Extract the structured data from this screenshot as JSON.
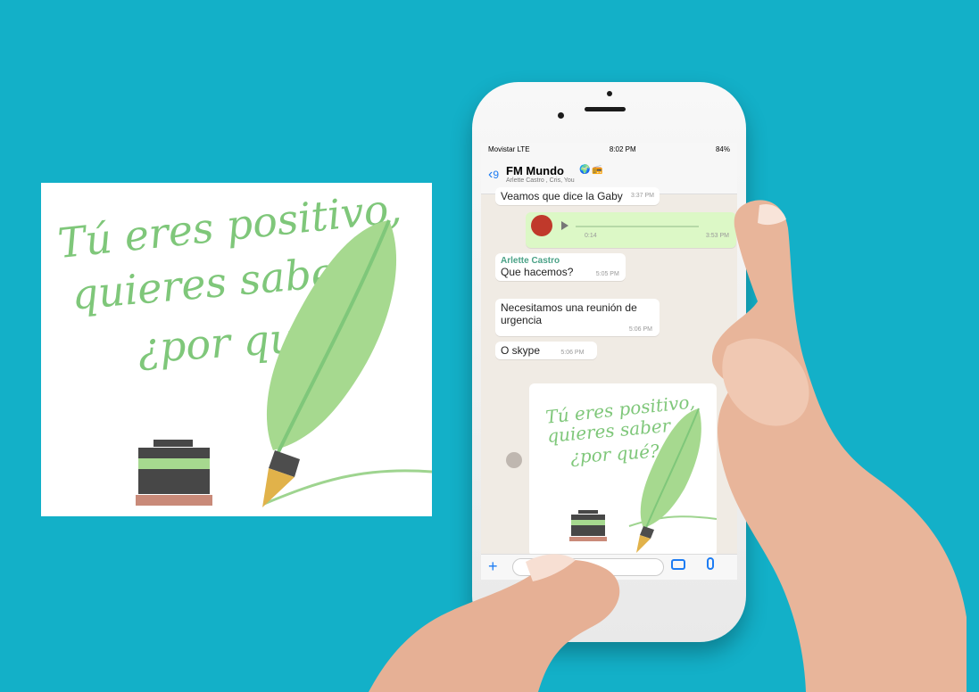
{
  "poster": {
    "line1": "Tú eres positivo,",
    "line2": "quieres saber",
    "line3": "¿por qué?"
  },
  "phone": {
    "status": {
      "carrier": "Movistar  LTE",
      "time": "8:02 PM",
      "battery": "84%"
    },
    "header": {
      "back": "‹",
      "unread": "9",
      "title": "FM Mundo",
      "members": "Arlette Castro , Cris, You"
    },
    "messages": [
      {
        "text": "Veamos que dice la Gaby",
        "time": "3:37 PM"
      },
      {
        "audio_elapsed": "0:14",
        "time": "3:53 PM"
      },
      {
        "sender": "Arlette Castro",
        "text": "Que hacemos?",
        "time": "5:05 PM"
      },
      {
        "text": "Necesitamos una reunión de urgencia",
        "time": "5:06 PM"
      },
      {
        "text": "O skype",
        "time": "5:06 PM"
      }
    ]
  }
}
